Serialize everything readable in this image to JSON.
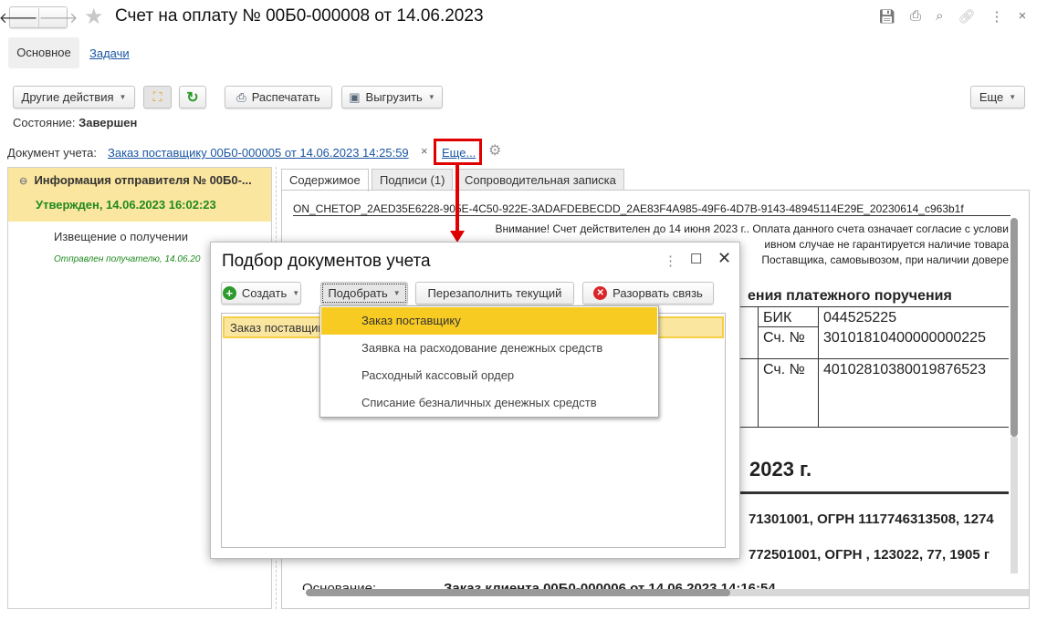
{
  "window": {
    "title": "Счет на оплату № 00Б0-000008 от 14.06.2023"
  },
  "nav_tabs": [
    {
      "label": "Основное"
    },
    {
      "label": "Задачи"
    }
  ],
  "toolbar": {
    "other_actions": "Другие действия",
    "print": "Распечатать",
    "export": "Выгрузить",
    "more": "Еще"
  },
  "status": {
    "label": "Состояние:",
    "value": "Завершен"
  },
  "account_doc": {
    "label": "Документ учета:",
    "link": "Заказ поставщику 00Б0-000005 от 14.06.2023 14:25:59",
    "clear": "×",
    "more": "Еще..."
  },
  "left_panel": {
    "header": "Информация отправителя № 00Б0-...",
    "approved": "Утвержден, 14.06.2023 16:02:23",
    "item": "Извещение о получении",
    "item_status": "Отправлен получателю, 14.06.20"
  },
  "doc_tabs": [
    {
      "label": "Содержимое"
    },
    {
      "label": "Подписи (1)"
    },
    {
      "label": "Сопроводительная записка"
    }
  ],
  "doc": {
    "filename": "ON_CHETOP_2AED35E6228-905E-4C50-922E-3ADAFDEBECDD_2AE83F4A985-49F6-4D7B-9143-48945114E29E_20230614_c963b1f",
    "notice1": "Внимание! Счет действителен до 14 июня 2023 г.. Оплата данного счета означает согласие с услови",
    "notice2": "ивном случае не гарантируется наличие товара",
    "notice3": "Поставщика, самовывозом, при наличии довере",
    "section": "ения платежного поручения",
    "bik_label": "БИК",
    "bik": "044525225",
    "acc_label": "Сч. №",
    "acc1": "30101810400000000225",
    "acc2": "40102810380019876523",
    "heading": "2023 г.",
    "line1": "71301001, ОГРН 1117746313508, 1274",
    "line2": "772501001, ОГРН , 123022, 77, 1905 г",
    "basis_label": "Основание:",
    "basis": "Заказ клиента 00Б0-000006 от 14.06.2023 14:16:54"
  },
  "dialog": {
    "title": "Подбор документов учета",
    "create": "Создать",
    "pick": "Подобрать",
    "refill": "Перезаполнить текущий",
    "unlink": "Разорвать связь",
    "row": "Заказ поставщику",
    "menu": [
      "Заказ поставщику",
      "Заявка на расходование денежных средств",
      "Расходный кассовый ордер",
      "Списание безналичных денежных средств"
    ]
  },
  "colors": {
    "highlight": "#fbe6a0",
    "menu_active": "#f8cb22",
    "link": "#1c56a3",
    "green": "#1f8a1f",
    "annotation": "#e00000"
  }
}
